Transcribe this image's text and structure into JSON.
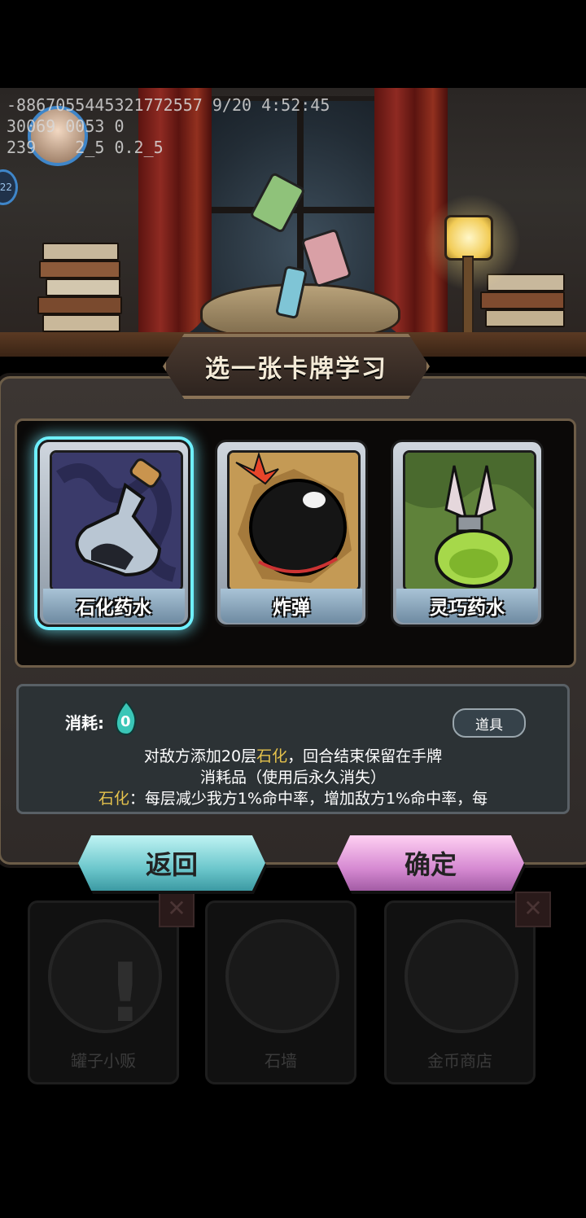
{
  "debug": {
    "line1": "-886705544532177​2557 9/20 4:52:45",
    "line2": "30069 0053 0",
    "line3": "239    2_5 0.2_5"
  },
  "side_badge": "22",
  "dialog": {
    "title": "选一张卡牌学习",
    "cards": [
      {
        "name": "石化药水",
        "icon": "petrify-potion-icon",
        "selected": true
      },
      {
        "name": "炸弹",
        "icon": "bomb-icon",
        "selected": false
      },
      {
        "name": "灵巧药水",
        "icon": "agility-potion-icon",
        "selected": false
      }
    ],
    "description": {
      "cost_label": "消耗:",
      "cost_value": "0",
      "type_tag": "道具",
      "line1_a": "对敌方添加20层",
      "line1_hl": "石化",
      "line1_b": "，回合结束保留在手牌",
      "line2": "消耗品（使用后永久消失）",
      "line3_hl": "石化",
      "line3_b": "：每层减少我方1%命中率，增加敌方1%命中率，每"
    },
    "back_label": "返回",
    "confirm_label": "确定"
  },
  "background_shops": [
    {
      "label": "罐子小贩",
      "icon": "exclamation-icon"
    },
    {
      "label": "石墙",
      "icon": "stone-wall-icon"
    },
    {
      "label": "金币商店",
      "icon": "merchant-icon"
    }
  ],
  "colors": {
    "highlight": "#e5c24c",
    "back_button": "#6cc7cc",
    "confirm_button": "#d68ad2",
    "selection_glow": "#6ef0ff"
  }
}
